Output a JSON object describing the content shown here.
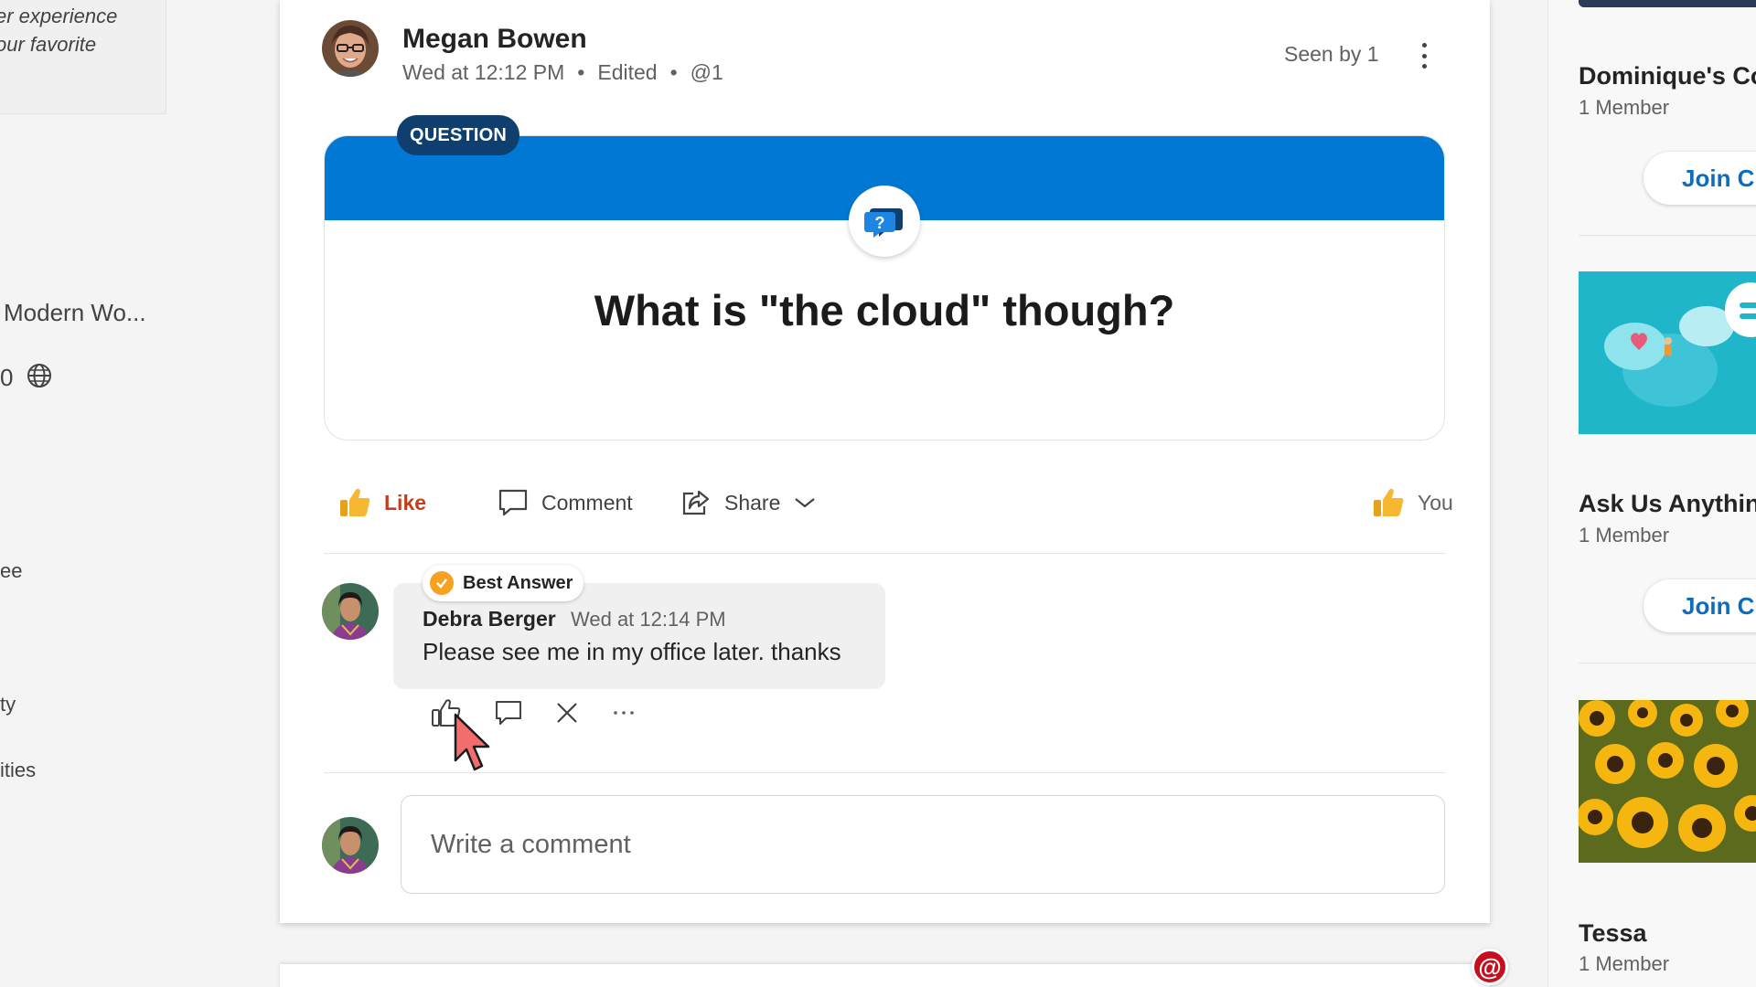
{
  "left": {
    "promo_line1": "er experience",
    "promo_line2": "our favorite",
    "community_name": "Modern Wo...",
    "count_fragment": "0",
    "label_ee": "ee",
    "label_ty": "ty",
    "label_ities": "ities"
  },
  "post": {
    "author": "Megan Bowen",
    "time": "Wed at 12:12 PM",
    "edited": "Edited",
    "mention": "@1",
    "seen_by": "Seen by 1",
    "badge": "QUESTION",
    "question": "What is \"the cloud\" though?",
    "actions": {
      "like": "Like",
      "comment": "Comment",
      "share": "Share",
      "reacted": "You"
    }
  },
  "comment": {
    "best_answer_label": "Best Answer",
    "author": "Debra Berger",
    "time": "Wed at 12:14 PM",
    "text": "Please see me in my office later.  thanks"
  },
  "composer": {
    "placeholder": "Write a comment"
  },
  "mention_fab": "@",
  "right": {
    "communities": [
      {
        "title": "Dominique's Co",
        "members": "1 Member",
        "join": "Join C"
      },
      {
        "title": "Ask Us Anything",
        "members": "1 Member",
        "join": "Join C"
      },
      {
        "title": "Tessa",
        "members": "1 Member"
      }
    ]
  },
  "colors": {
    "brand_blue": "#0078d4",
    "badge_navy": "#0f3f6e",
    "like_orange": "#c43e1c",
    "best_answer_gold": "#f7a120",
    "link_blue": "#0f6cbd",
    "mention_red": "#c50f1f"
  }
}
